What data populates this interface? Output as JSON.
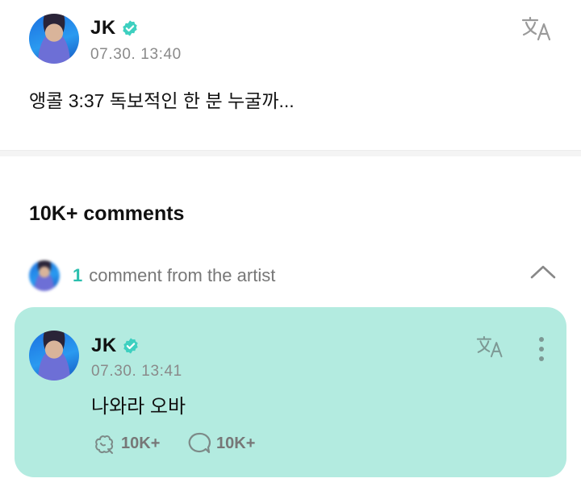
{
  "post": {
    "author": "JK",
    "timestamp": "07.30. 13:40",
    "text": "앵콜 3:37 독보적인 한 분 누굴까..."
  },
  "comments": {
    "title": "10K+ comments",
    "artist_section": {
      "count": "1",
      "label": "comment from the artist"
    },
    "artist_comment": {
      "author": "JK",
      "timestamp": "07.30. 13:41",
      "text": "나와라 오바",
      "likes": "10K+",
      "replies": "10K+"
    }
  },
  "colors": {
    "accent": "#2bbfae",
    "card_background": "#b3ebe0",
    "verified": "#3ed0c0"
  },
  "icons": [
    "verified-icon",
    "translate-icon",
    "chevron-up-icon",
    "like-icon",
    "reply-icon",
    "more-icon"
  ]
}
